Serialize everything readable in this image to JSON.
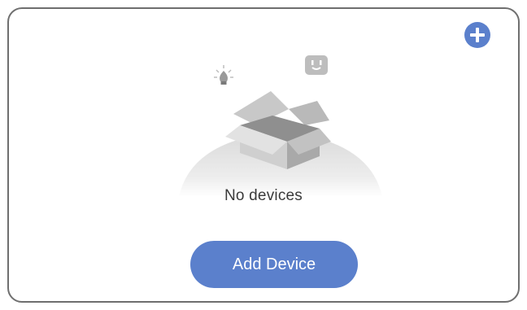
{
  "header": {
    "add_icon": "plus-circle-icon"
  },
  "empty_state": {
    "label": "No devices",
    "illustration_icons": [
      "lightbulb-icon",
      "smart-plug-icon",
      "open-box-icon"
    ]
  },
  "actions": {
    "add_device_label": "Add Device"
  },
  "colors": {
    "accent": "#5b80cc",
    "border": "#6f6f6f",
    "text": "#3a3a3a"
  }
}
